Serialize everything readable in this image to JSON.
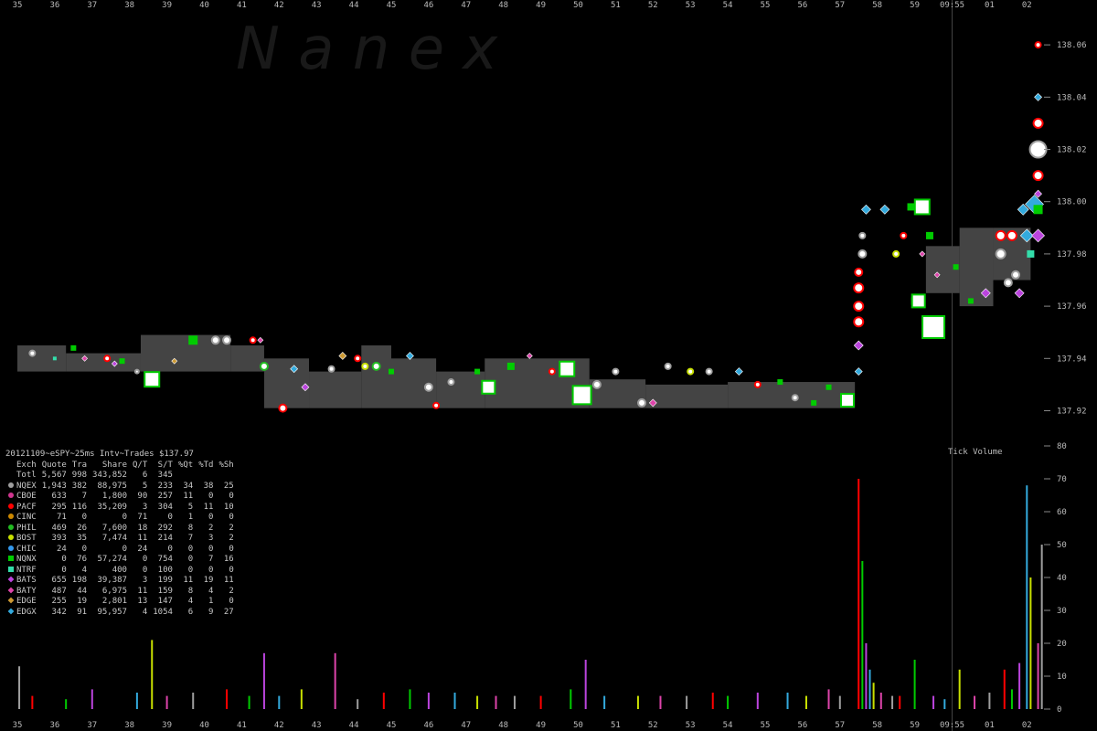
{
  "chart_data": {
    "type": "scatter",
    "watermark": "N a n e x",
    "x_ticks": [
      "35",
      "36",
      "37",
      "38",
      "39",
      "40",
      "41",
      "42",
      "43",
      "44",
      "45",
      "46",
      "47",
      "48",
      "49",
      "50",
      "51",
      "52",
      "53",
      "54",
      "55",
      "56",
      "57",
      "58",
      "59",
      "09:55",
      "01",
      "02"
    ],
    "price_axis": {
      "ticks": [
        "138.06",
        "138.04",
        "138.02",
        "138.00",
        "137.98",
        "137.96",
        "137.94",
        "137.92"
      ],
      "ylim": [
        137.91,
        138.07
      ]
    },
    "volume_axis": {
      "label": "Tick Volume",
      "ticks": [
        "80",
        "70",
        "60",
        "50",
        "40",
        "30",
        "20",
        "10",
        "0"
      ],
      "ylim": [
        0,
        80
      ]
    },
    "stats_title": "20121109~eSPY~25ms Intv~Trades $137.97",
    "stats_columns": [
      "Exch",
      "Quote",
      "Tra",
      "Share",
      "Q/T",
      "S/T",
      "%Qt",
      "%Td",
      "%Sh"
    ],
    "stats_total": [
      "Totl",
      "5,567",
      "998",
      "343,852",
      "6",
      "345",
      "",
      "",
      ""
    ],
    "stats_rows": [
      {
        "ex": "NQEX",
        "color": "#9e9e9e",
        "shape": "circle",
        "vals": [
          "1,943",
          "382",
          "88,975",
          "5",
          "233",
          "34",
          "38",
          "25"
        ]
      },
      {
        "ex": "CBOE",
        "color": "#d0368f",
        "shape": "circle",
        "vals": [
          "633",
          "7",
          "1,800",
          "90",
          "257",
          "11",
          "0",
          "0"
        ]
      },
      {
        "ex": "PACF",
        "color": "#ff0000",
        "shape": "circle",
        "vals": [
          "295",
          "116",
          "35,209",
          "3",
          "304",
          "5",
          "11",
          "10"
        ]
      },
      {
        "ex": "CINC",
        "color": "#cc8800",
        "shape": "circle",
        "vals": [
          "71",
          "0",
          "0",
          "71",
          "0",
          "1",
          "0",
          "0"
        ]
      },
      {
        "ex": "PHIL",
        "color": "#22bb22",
        "shape": "circle",
        "vals": [
          "469",
          "26",
          "7,600",
          "18",
          "292",
          "8",
          "2",
          "2"
        ]
      },
      {
        "ex": "BOST",
        "color": "#c8e000",
        "shape": "circle",
        "vals": [
          "393",
          "35",
          "7,474",
          "11",
          "214",
          "7",
          "3",
          "2"
        ]
      },
      {
        "ex": "CHIC",
        "color": "#3399ee",
        "shape": "circle",
        "vals": [
          "24",
          "0",
          "0",
          "24",
          "0",
          "0",
          "0",
          "0"
        ]
      },
      {
        "ex": "NQNX",
        "color": "#00cc00",
        "shape": "square",
        "vals": [
          "0",
          "76",
          "57,274",
          "0",
          "754",
          "0",
          "7",
          "16"
        ]
      },
      {
        "ex": "NTRF",
        "color": "#33ddaa",
        "shape": "square",
        "vals": [
          "0",
          "4",
          "400",
          "0",
          "100",
          "0",
          "0",
          "0"
        ]
      },
      {
        "ex": "BATS",
        "color": "#bb44dd",
        "shape": "diamond",
        "vals": [
          "655",
          "198",
          "39,387",
          "3",
          "199",
          "11",
          "19",
          "11"
        ]
      },
      {
        "ex": "BATY",
        "color": "#dd44aa",
        "shape": "diamond",
        "vals": [
          "487",
          "44",
          "6,975",
          "11",
          "159",
          "8",
          "4",
          "2"
        ]
      },
      {
        "ex": "EDGE",
        "color": "#cc9933",
        "shape": "diamond",
        "vals": [
          "255",
          "19",
          "2,801",
          "13",
          "147",
          "4",
          "1",
          "0"
        ]
      },
      {
        "ex": "EDGX",
        "color": "#33aadd",
        "shape": "diamond",
        "vals": [
          "342",
          "91",
          "95,957",
          "4",
          "1054",
          "6",
          "9",
          "27"
        ]
      }
    ],
    "nbbo_bands": [
      {
        "x": [
          0.0,
          1.3
        ],
        "bid": 137.935,
        "ask": 137.945
      },
      {
        "x": [
          1.3,
          3.3
        ],
        "bid": 137.935,
        "ask": 137.942
      },
      {
        "x": [
          3.3,
          5.7
        ],
        "bid": 137.935,
        "ask": 137.949
      },
      {
        "x": [
          5.7,
          6.6
        ],
        "bid": 137.935,
        "ask": 137.945
      },
      {
        "x": [
          6.6,
          7.8
        ],
        "bid": 137.921,
        "ask": 137.94
      },
      {
        "x": [
          7.8,
          9.2
        ],
        "bid": 137.921,
        "ask": 137.935
      },
      {
        "x": [
          9.2,
          10.0
        ],
        "bid": 137.921,
        "ask": 137.945
      },
      {
        "x": [
          10.0,
          11.2
        ],
        "bid": 137.921,
        "ask": 137.94
      },
      {
        "x": [
          11.2,
          12.5
        ],
        "bid": 137.921,
        "ask": 137.935
      },
      {
        "x": [
          12.5,
          15.3
        ],
        "bid": 137.921,
        "ask": 137.94
      },
      {
        "x": [
          15.3,
          16.8
        ],
        "bid": 137.921,
        "ask": 137.932
      },
      {
        "x": [
          16.8,
          19.0
        ],
        "bid": 137.921,
        "ask": 137.93
      },
      {
        "x": [
          19.0,
          22.4
        ],
        "bid": 137.921,
        "ask": 137.931
      },
      {
        "x": [
          24.3,
          25.2
        ],
        "bid": 137.965,
        "ask": 137.983
      },
      {
        "x": [
          25.2,
          26.1
        ],
        "bid": 137.96,
        "ask": 137.99
      },
      {
        "x": [
          26.1,
          27.1
        ],
        "bid": 137.97,
        "ask": 137.99
      }
    ],
    "trades": [
      {
        "x": 0.4,
        "y": 137.942,
        "ex": "NQEX",
        "s": 3
      },
      {
        "x": 1.0,
        "y": 137.94,
        "ex": "NTRF",
        "s": 2
      },
      {
        "x": 1.5,
        "y": 137.944,
        "ex": "NQNX",
        "s": 3
      },
      {
        "x": 1.8,
        "y": 137.94,
        "ex": "BATY",
        "s": 2
      },
      {
        "x": 2.4,
        "y": 137.94,
        "ex": "PACF",
        "s": 3
      },
      {
        "x": 2.8,
        "y": 137.939,
        "ex": "NQNX",
        "s": 3
      },
      {
        "x": 2.6,
        "y": 137.938,
        "ex": "BATS",
        "s": 2
      },
      {
        "x": 3.2,
        "y": 137.935,
        "ex": "NQEX",
        "s": 2
      },
      {
        "x": 3.6,
        "y": 137.932,
        "ex": "NQNX",
        "s": 8
      },
      {
        "x": 4.2,
        "y": 137.939,
        "ex": "EDGE",
        "s": 2
      },
      {
        "x": 4.7,
        "y": 137.947,
        "ex": "NQNX",
        "s": 5
      },
      {
        "x": 5.3,
        "y": 137.947,
        "ex": "NQEX",
        "s": 4
      },
      {
        "x": 5.6,
        "y": 137.947,
        "ex": "NQEX",
        "s": 4
      },
      {
        "x": 6.3,
        "y": 137.947,
        "ex": "PACF",
        "s": 3
      },
      {
        "x": 6.5,
        "y": 137.947,
        "ex": "BATY",
        "s": 2
      },
      {
        "x": 6.6,
        "y": 137.937,
        "ex": "PHIL",
        "s": 4
      },
      {
        "x": 7.1,
        "y": 137.921,
        "ex": "PACF",
        "s": 4
      },
      {
        "x": 7.4,
        "y": 137.936,
        "ex": "EDGX",
        "s": 3
      },
      {
        "x": 7.7,
        "y": 137.929,
        "ex": "BATS",
        "s": 3
      },
      {
        "x": 8.4,
        "y": 137.936,
        "ex": "NQEX",
        "s": 3
      },
      {
        "x": 8.7,
        "y": 137.941,
        "ex": "EDGE",
        "s": 3
      },
      {
        "x": 9.1,
        "y": 137.94,
        "ex": "PACF",
        "s": 3
      },
      {
        "x": 9.3,
        "y": 137.937,
        "ex": "BOST",
        "s": 3
      },
      {
        "x": 9.6,
        "y": 137.937,
        "ex": "PHIL",
        "s": 4
      },
      {
        "x": 10.0,
        "y": 137.935,
        "ex": "NQNX",
        "s": 3
      },
      {
        "x": 10.5,
        "y": 137.941,
        "ex": "EDGX",
        "s": 3
      },
      {
        "x": 11.0,
        "y": 137.929,
        "ex": "NQEX",
        "s": 4
      },
      {
        "x": 11.2,
        "y": 137.922,
        "ex": "PACF",
        "s": 3
      },
      {
        "x": 11.6,
        "y": 137.931,
        "ex": "NQEX",
        "s": 3
      },
      {
        "x": 12.3,
        "y": 137.935,
        "ex": "NQNX",
        "s": 3
      },
      {
        "x": 12.6,
        "y": 137.929,
        "ex": "NQNX",
        "s": 7
      },
      {
        "x": 13.2,
        "y": 137.937,
        "ex": "NQNX",
        "s": 4
      },
      {
        "x": 13.7,
        "y": 137.941,
        "ex": "BATY",
        "s": 2
      },
      {
        "x": 14.3,
        "y": 137.935,
        "ex": "PACF",
        "s": 3
      },
      {
        "x": 14.7,
        "y": 137.936,
        "ex": "NQNX",
        "s": 8
      },
      {
        "x": 15.1,
        "y": 137.926,
        "ex": "NQNX",
        "s": 10
      },
      {
        "x": 15.5,
        "y": 137.93,
        "ex": "NQEX",
        "s": 4
      },
      {
        "x": 16.0,
        "y": 137.935,
        "ex": "NQEX",
        "s": 3
      },
      {
        "x": 16.7,
        "y": 137.923,
        "ex": "NQEX",
        "s": 4
      },
      {
        "x": 17.0,
        "y": 137.923,
        "ex": "BATY",
        "s": 3
      },
      {
        "x": 17.4,
        "y": 137.937,
        "ex": "NQEX",
        "s": 3
      },
      {
        "x": 18.0,
        "y": 137.935,
        "ex": "BOST",
        "s": 3
      },
      {
        "x": 18.5,
        "y": 137.935,
        "ex": "NQEX",
        "s": 3
      },
      {
        "x": 19.3,
        "y": 137.935,
        "ex": "EDGX",
        "s": 3
      },
      {
        "x": 19.8,
        "y": 137.93,
        "ex": "PACF",
        "s": 3
      },
      {
        "x": 20.4,
        "y": 137.931,
        "ex": "NQNX",
        "s": 3
      },
      {
        "x": 20.8,
        "y": 137.925,
        "ex": "NQEX",
        "s": 3
      },
      {
        "x": 21.3,
        "y": 137.923,
        "ex": "NQNX",
        "s": 3
      },
      {
        "x": 21.7,
        "y": 137.929,
        "ex": "NQNX",
        "s": 3
      },
      {
        "x": 22.2,
        "y": 137.924,
        "ex": "NQNX",
        "s": 7
      },
      {
        "x": 22.5,
        "y": 137.935,
        "ex": "EDGX",
        "s": 3
      },
      {
        "x": 22.5,
        "y": 137.945,
        "ex": "BATS",
        "s": 4
      },
      {
        "x": 22.5,
        "y": 137.954,
        "ex": "PACF",
        "s": 5
      },
      {
        "x": 22.5,
        "y": 137.96,
        "ex": "PACF",
        "s": 5
      },
      {
        "x": 22.5,
        "y": 137.967,
        "ex": "PACF",
        "s": 5
      },
      {
        "x": 22.5,
        "y": 137.973,
        "ex": "PACF",
        "s": 4
      },
      {
        "x": 22.6,
        "y": 137.98,
        "ex": "NQEX",
        "s": 4
      },
      {
        "x": 22.6,
        "y": 137.987,
        "ex": "NQEX",
        "s": 3
      },
      {
        "x": 22.7,
        "y": 137.997,
        "ex": "EDGX",
        "s": 4
      },
      {
        "x": 23.2,
        "y": 137.997,
        "ex": "EDGX",
        "s": 4
      },
      {
        "x": 23.5,
        "y": 137.98,
        "ex": "BOST",
        "s": 3
      },
      {
        "x": 23.7,
        "y": 137.987,
        "ex": "PACF",
        "s": 3
      },
      {
        "x": 23.9,
        "y": 137.998,
        "ex": "NQNX",
        "s": 4
      },
      {
        "x": 24.2,
        "y": 137.998,
        "ex": "NQNX",
        "s": 8
      },
      {
        "x": 24.4,
        "y": 137.987,
        "ex": "NQNX",
        "s": 4
      },
      {
        "x": 24.2,
        "y": 137.98,
        "ex": "BATY",
        "s": 2
      },
      {
        "x": 24.0,
        "y": 137.962,
        "ex": "NQNX",
        "s": 4
      },
      {
        "x": 24.1,
        "y": 137.962,
        "ex": "NQNX",
        "s": 7
      },
      {
        "x": 24.5,
        "y": 137.952,
        "ex": "NQNX",
        "s": 12
      },
      {
        "x": 24.6,
        "y": 137.972,
        "ex": "BATY",
        "s": 2
      },
      {
        "x": 25.1,
        "y": 137.975,
        "ex": "NQNX",
        "s": 3
      },
      {
        "x": 25.5,
        "y": 137.962,
        "ex": "NQNX",
        "s": 3
      },
      {
        "x": 25.9,
        "y": 137.965,
        "ex": "BATS",
        "s": 4
      },
      {
        "x": 26.3,
        "y": 137.98,
        "ex": "NQEX",
        "s": 5
      },
      {
        "x": 26.3,
        "y": 137.987,
        "ex": "PACF",
        "s": 5
      },
      {
        "x": 26.5,
        "y": 137.969,
        "ex": "NQEX",
        "s": 4
      },
      {
        "x": 26.6,
        "y": 137.987,
        "ex": "PACF",
        "s": 5
      },
      {
        "x": 26.7,
        "y": 137.972,
        "ex": "NQEX",
        "s": 4
      },
      {
        "x": 26.8,
        "y": 137.965,
        "ex": "BATS",
        "s": 4
      },
      {
        "x": 26.9,
        "y": 137.997,
        "ex": "EDGX",
        "s": 5
      },
      {
        "x": 27.0,
        "y": 137.987,
        "ex": "EDGX",
        "s": 6
      },
      {
        "x": 27.1,
        "y": 137.98,
        "ex": "NTRF",
        "s": 4
      },
      {
        "x": 27.2,
        "y": 137.999,
        "ex": "EDGX",
        "s": 9
      },
      {
        "x": 27.3,
        "y": 137.997,
        "ex": "NQNX",
        "s": 5
      },
      {
        "x": 27.3,
        "y": 137.987,
        "ex": "BATS",
        "s": 6
      },
      {
        "x": 27.3,
        "y": 138.003,
        "ex": "BATS",
        "s": 3
      },
      {
        "x": 27.3,
        "y": 138.01,
        "ex": "PACF",
        "s": 5
      },
      {
        "x": 27.3,
        "y": 138.02,
        "ex": "NQEX",
        "s": 9
      },
      {
        "x": 27.3,
        "y": 138.03,
        "ex": "PACF",
        "s": 5
      },
      {
        "x": 27.3,
        "y": 138.04,
        "ex": "EDGX",
        "s": 3
      },
      {
        "x": 27.3,
        "y": 138.06,
        "ex": "PACF",
        "s": 3
      }
    ],
    "volume_bars": [
      {
        "x": 0.05,
        "v": 13
      },
      {
        "x": 0.4,
        "v": 4
      },
      {
        "x": 1.3,
        "v": 3
      },
      {
        "x": 2.0,
        "v": 6
      },
      {
        "x": 3.2,
        "v": 5
      },
      {
        "x": 3.6,
        "v": 21
      },
      {
        "x": 4.0,
        "v": 4
      },
      {
        "x": 4.7,
        "v": 5
      },
      {
        "x": 5.6,
        "v": 6
      },
      {
        "x": 6.2,
        "v": 4
      },
      {
        "x": 6.6,
        "v": 17
      },
      {
        "x": 7.0,
        "v": 4
      },
      {
        "x": 7.6,
        "v": 6
      },
      {
        "x": 8.5,
        "v": 17
      },
      {
        "x": 9.1,
        "v": 3
      },
      {
        "x": 9.8,
        "v": 5
      },
      {
        "x": 10.5,
        "v": 6
      },
      {
        "x": 11.0,
        "v": 5
      },
      {
        "x": 11.7,
        "v": 5
      },
      {
        "x": 12.3,
        "v": 4
      },
      {
        "x": 12.8,
        "v": 4
      },
      {
        "x": 13.3,
        "v": 4
      },
      {
        "x": 14.0,
        "v": 4
      },
      {
        "x": 14.8,
        "v": 6
      },
      {
        "x": 15.2,
        "v": 15
      },
      {
        "x": 15.7,
        "v": 4
      },
      {
        "x": 16.6,
        "v": 4
      },
      {
        "x": 17.2,
        "v": 4
      },
      {
        "x": 17.9,
        "v": 4
      },
      {
        "x": 18.6,
        "v": 5
      },
      {
        "x": 19.0,
        "v": 4
      },
      {
        "x": 19.8,
        "v": 5
      },
      {
        "x": 20.6,
        "v": 5
      },
      {
        "x": 21.1,
        "v": 4
      },
      {
        "x": 21.7,
        "v": 6
      },
      {
        "x": 22.0,
        "v": 4
      },
      {
        "x": 22.5,
        "v": 70
      },
      {
        "x": 22.6,
        "v": 45
      },
      {
        "x": 22.7,
        "v": 20
      },
      {
        "x": 22.8,
        "v": 12
      },
      {
        "x": 22.9,
        "v": 8
      },
      {
        "x": 23.1,
        "v": 5
      },
      {
        "x": 23.4,
        "v": 4
      },
      {
        "x": 23.6,
        "v": 4
      },
      {
        "x": 24.0,
        "v": 15
      },
      {
        "x": 24.5,
        "v": 4
      },
      {
        "x": 24.8,
        "v": 3
      },
      {
        "x": 25.2,
        "v": 12
      },
      {
        "x": 25.6,
        "v": 4
      },
      {
        "x": 26.0,
        "v": 5
      },
      {
        "x": 26.4,
        "v": 12
      },
      {
        "x": 26.6,
        "v": 6
      },
      {
        "x": 26.8,
        "v": 14
      },
      {
        "x": 27.0,
        "v": 68
      },
      {
        "x": 27.1,
        "v": 40
      },
      {
        "x": 27.3,
        "v": 20
      },
      {
        "x": 27.4,
        "v": 50
      }
    ]
  }
}
